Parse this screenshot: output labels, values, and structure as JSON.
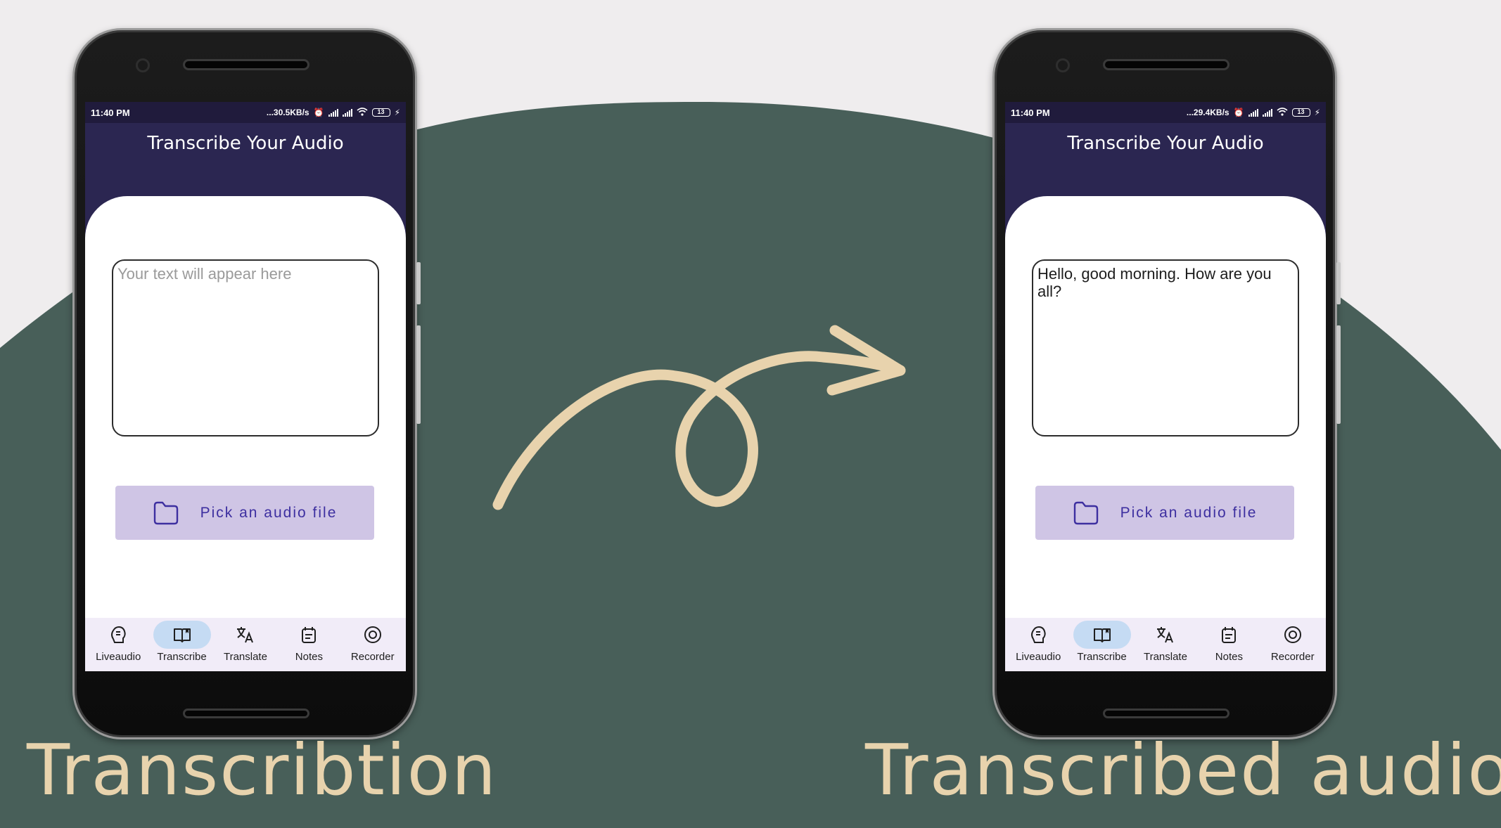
{
  "colors": {
    "background": "#efedee",
    "blob": "#485f59",
    "arrow": "#e8d3ad",
    "caption": "#e8d3ad",
    "app_header": "#2b2651",
    "status_bar": "#201b3c",
    "button_bg": "#cfc5e5",
    "button_text": "#3d2fa0",
    "nav_bg": "#f1ecf8",
    "nav_active": "#c5dbf3"
  },
  "left_phone": {
    "status": {
      "time": "11:40 PM",
      "speed": "...30.5KB/s",
      "battery": "13"
    },
    "title": "Transcribe Your Audio",
    "textbox": {
      "text": "",
      "placeholder": "Your text will appear here"
    },
    "pick_button": "Pick an audio file",
    "nav": {
      "active": "Transcribe",
      "items": [
        "Liveaudio",
        "Transcribe",
        "Translate",
        "Notes",
        "Recorder"
      ]
    }
  },
  "right_phone": {
    "status": {
      "time": "11:40 PM",
      "speed": "...29.4KB/s",
      "battery": "13"
    },
    "title": "Transcribe Your Audio",
    "textbox": {
      "text": "Hello, good morning. How are you all?",
      "placeholder": "Your text will appear here"
    },
    "pick_button": "Pick an audio file",
    "nav": {
      "active": "Transcribe",
      "items": [
        "Liveaudio",
        "Transcribe",
        "Translate",
        "Notes",
        "Recorder"
      ]
    }
  },
  "captions": {
    "left": "Transcribtion",
    "right": "Transcribed audio"
  },
  "icons": {
    "folder": "folder-icon",
    "liveaudio": "live-audio-icon",
    "transcribe": "book-open-icon",
    "translate": "translate-icon",
    "notes": "notes-icon",
    "recorder": "record-icon"
  }
}
